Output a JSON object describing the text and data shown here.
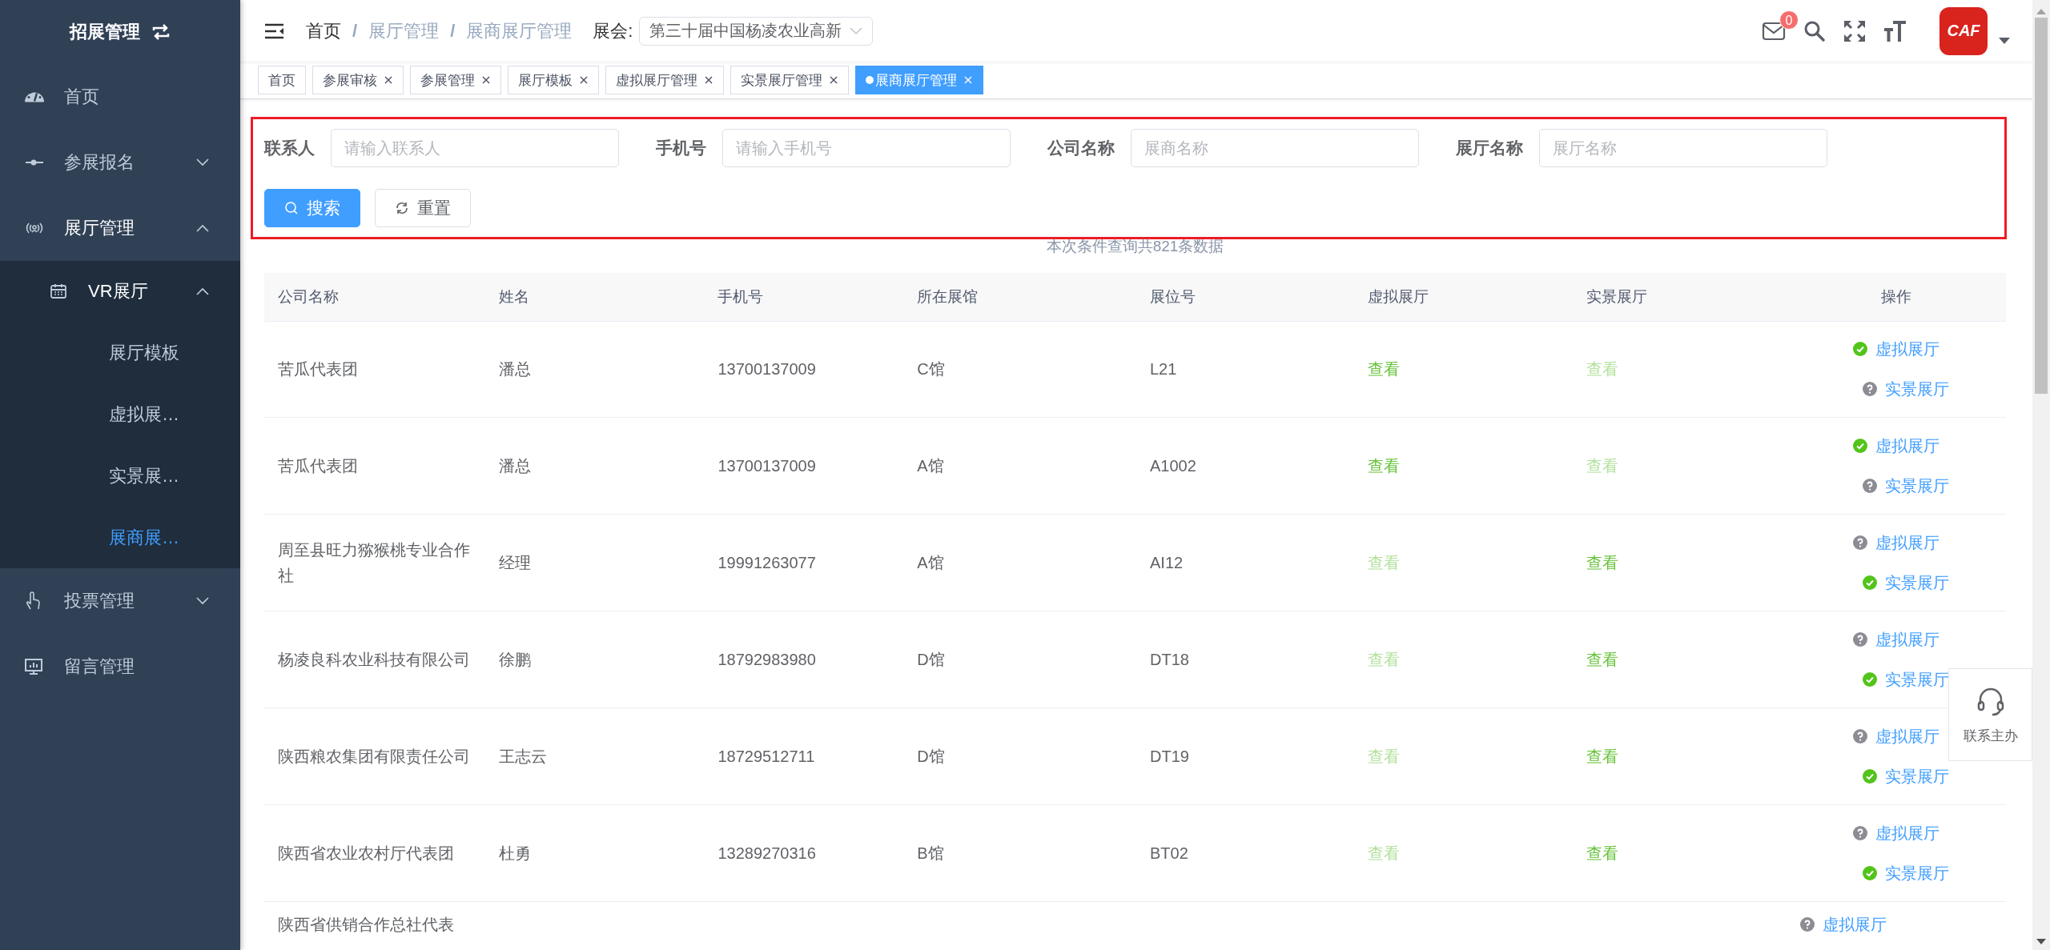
{
  "sidebar": {
    "title": "招展管理",
    "items": [
      {
        "label": "首页",
        "selected": false
      },
      {
        "label": "参展报名",
        "selected": false,
        "expanded": false
      },
      {
        "label": "展厅管理",
        "selected": false,
        "expanded": true,
        "children": [
          {
            "label": "VR展厅",
            "selected": false,
            "expanded": true,
            "children": [
              {
                "label": "展厅模板",
                "selected": false
              },
              {
                "label": "虚拟展…",
                "selected": false
              },
              {
                "label": "实景展…",
                "selected": false
              },
              {
                "label": "展商展…",
                "selected": true
              }
            ]
          }
        ]
      },
      {
        "label": "投票管理",
        "selected": false,
        "expanded": false
      },
      {
        "label": "留言管理",
        "selected": false
      }
    ]
  },
  "header": {
    "breadcrumb_separator": "/",
    "breadcrumb": [
      {
        "label": "首页",
        "current": true
      },
      {
        "label": "展厅管理",
        "current": false
      },
      {
        "label": "展商展厅管理",
        "current": false
      }
    ],
    "event_label": "展会:",
    "event_select": {
      "value": "第三十届中国杨凌农业高新"
    },
    "mail_badge": "0",
    "logo": {
      "text": "CAF"
    }
  },
  "tabs": [
    {
      "label": "首页",
      "selected": false,
      "closable": false
    },
    {
      "label": "参展审核",
      "selected": false,
      "closable": true
    },
    {
      "label": "参展管理",
      "selected": false,
      "closable": true
    },
    {
      "label": "展厅模板",
      "selected": false,
      "closable": true
    },
    {
      "label": "虚拟展厅管理",
      "selected": false,
      "closable": true
    },
    {
      "label": "实景展厅管理",
      "selected": false,
      "closable": true
    },
    {
      "label": "展商展厅管理",
      "selected": true,
      "closable": true
    }
  ],
  "filters": {
    "fields": [
      {
        "label": "联系人",
        "placeholder": "请输入联系人"
      },
      {
        "label": "手机号",
        "placeholder": "请输入手机号"
      },
      {
        "label": "公司名称",
        "placeholder": "展商名称"
      },
      {
        "label": "展厅名称",
        "placeholder": "展厅名称"
      }
    ],
    "buttons": [
      {
        "label": "搜索",
        "kind": "primary"
      },
      {
        "label": "重置",
        "kind": "reset"
      }
    ]
  },
  "summary": "本次条件查询共821条数据",
  "table": {
    "columns": [
      "公司名称",
      "姓名",
      "手机号",
      "所在展馆",
      "展位号",
      "虚拟展厅",
      "实景展厅",
      "操作"
    ],
    "rows": [
      {
        "company": "苦瓜代表团",
        "name": "潘总",
        "phone": "13700137009",
        "hall": "C馆",
        "booth": "L21",
        "virtual": {
          "label": "查看",
          "available": true
        },
        "real": {
          "label": "查看",
          "available": false
        },
        "actions": [
          {
            "label": "虚拟展厅",
            "done": true
          },
          {
            "label": "实景展厅",
            "done": false
          }
        ]
      },
      {
        "company": "苦瓜代表团",
        "name": "潘总",
        "phone": "13700137009",
        "hall": "A馆",
        "booth": "A1002",
        "virtual": {
          "label": "查看",
          "available": true
        },
        "real": {
          "label": "查看",
          "available": false
        },
        "actions": [
          {
            "label": "虚拟展厅",
            "done": true
          },
          {
            "label": "实景展厅",
            "done": false
          }
        ]
      },
      {
        "company": "周至县旺力猕猴桃专业合作社",
        "name": "经理",
        "phone": "19991263077",
        "hall": "A馆",
        "booth": "AI12",
        "virtual": {
          "label": "查看",
          "available": false
        },
        "real": {
          "label": "查看",
          "available": true
        },
        "actions": [
          {
            "label": "虚拟展厅",
            "done": false
          },
          {
            "label": "实景展厅",
            "done": true
          }
        ]
      },
      {
        "company": "杨凌良科农业科技有限公司",
        "name": "徐鹏",
        "phone": "18792983980",
        "hall": "D馆",
        "booth": "DT18",
        "virtual": {
          "label": "查看",
          "available": false
        },
        "real": {
          "label": "查看",
          "available": true
        },
        "actions": [
          {
            "label": "虚拟展厅",
            "done": false
          },
          {
            "label": "实景展厅",
            "done": true
          }
        ]
      },
      {
        "company": "陕西粮农集团有限责任公司",
        "name": "王志云",
        "phone": "18729512711",
        "hall": "D馆",
        "booth": "DT19",
        "virtual": {
          "label": "查看",
          "available": false
        },
        "real": {
          "label": "查看",
          "available": true
        },
        "actions": [
          {
            "label": "虚拟展厅",
            "done": false
          },
          {
            "label": "实景展厅",
            "done": true
          }
        ]
      },
      {
        "company": "陕西省农业农村厅代表团",
        "name": "杜勇",
        "phone": "13289270316",
        "hall": "B馆",
        "booth": "BT02",
        "virtual": {
          "label": "查看",
          "available": false
        },
        "real": {
          "label": "查看",
          "available": true
        },
        "actions": [
          {
            "label": "虚拟展厅",
            "done": false
          },
          {
            "label": "实景展厅",
            "done": true
          }
        ]
      },
      {
        "company": "陕西省供销合作总社代表",
        "actions": [
          {
            "label": "虚拟展厅",
            "done": false
          }
        ]
      }
    ]
  },
  "contact": {
    "label": "联系主办"
  }
}
